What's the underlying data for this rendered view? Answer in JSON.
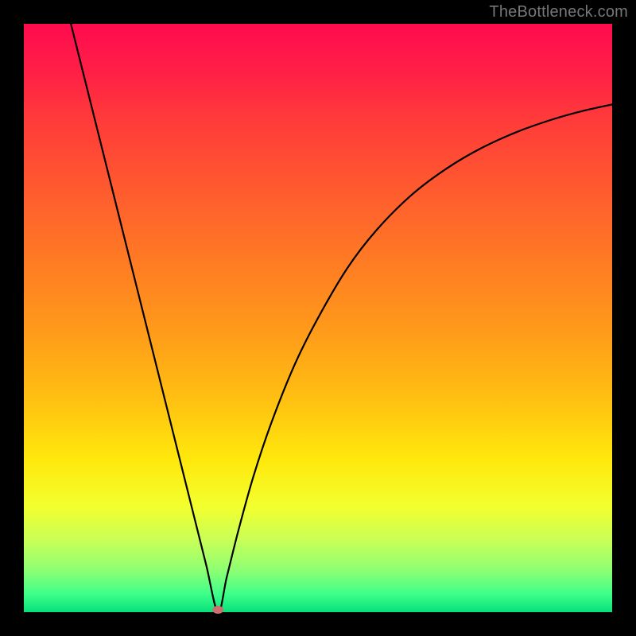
{
  "watermark": "TheBottleneck.com",
  "colors": {
    "frame_bg": "#000000",
    "curve_stroke": "#000000",
    "marker_fill": "#cc6f6f",
    "gradient_top": "#ff0b4e",
    "gradient_bottom": "#07e07a"
  },
  "chart_data": {
    "type": "line",
    "title": "",
    "xlabel": "",
    "ylabel": "",
    "xlim": [
      0,
      100
    ],
    "ylim": [
      0,
      100
    ],
    "grid": false,
    "min_point": {
      "x": 33,
      "y": 0
    },
    "curve_points": [
      {
        "x": 8.0,
        "y": 100.0
      },
      {
        "x": 10.0,
        "y": 92.0
      },
      {
        "x": 14.0,
        "y": 76.0
      },
      {
        "x": 18.0,
        "y": 60.0
      },
      {
        "x": 22.0,
        "y": 44.0
      },
      {
        "x": 26.0,
        "y": 28.0
      },
      {
        "x": 29.0,
        "y": 16.0
      },
      {
        "x": 31.0,
        "y": 8.0
      },
      {
        "x": 33.0,
        "y": 0.0
      },
      {
        "x": 34.5,
        "y": 6.0
      },
      {
        "x": 36.5,
        "y": 14.0
      },
      {
        "x": 39.0,
        "y": 23.0
      },
      {
        "x": 42.0,
        "y": 32.0
      },
      {
        "x": 46.0,
        "y": 42.0
      },
      {
        "x": 50.0,
        "y": 50.0
      },
      {
        "x": 55.0,
        "y": 58.5
      },
      {
        "x": 60.0,
        "y": 65.0
      },
      {
        "x": 66.0,
        "y": 71.0
      },
      {
        "x": 72.0,
        "y": 75.5
      },
      {
        "x": 78.0,
        "y": 79.0
      },
      {
        "x": 84.0,
        "y": 81.7
      },
      {
        "x": 90.0,
        "y": 83.8
      },
      {
        "x": 95.0,
        "y": 85.2
      },
      {
        "x": 100.0,
        "y": 86.3
      }
    ]
  }
}
